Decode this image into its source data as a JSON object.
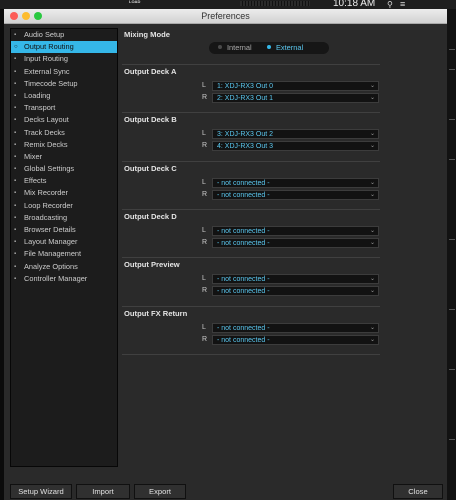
{
  "menubar": {
    "load_label": "LOAD",
    "clock": "10:18 AM",
    "search_icon": "search-icon",
    "menu_icon": "menu-list-icon"
  },
  "window": {
    "title": "Preferences"
  },
  "sidebar": {
    "items": [
      {
        "label": "Audio Setup"
      },
      {
        "label": "Output Routing",
        "active": true
      },
      {
        "label": "Input Routing"
      },
      {
        "label": "External Sync"
      },
      {
        "label": "Timecode Setup"
      },
      {
        "label": "Loading"
      },
      {
        "label": "Transport"
      },
      {
        "label": "Decks Layout"
      },
      {
        "label": "Track Decks"
      },
      {
        "label": "Remix Decks"
      },
      {
        "label": "Mixer"
      },
      {
        "label": "Global Settings"
      },
      {
        "label": "Effects"
      },
      {
        "label": "Mix Recorder"
      },
      {
        "label": "Loop Recorder"
      },
      {
        "label": "Broadcasting"
      },
      {
        "label": "Browser Details"
      },
      {
        "label": "Layout Manager"
      },
      {
        "label": "File Management"
      },
      {
        "label": "Analyze Options"
      },
      {
        "label": "Controller Manager"
      }
    ]
  },
  "mixing_mode": {
    "title": "Mixing Mode",
    "options": [
      {
        "label": "Internal",
        "selected": false
      },
      {
        "label": "External",
        "selected": true
      }
    ]
  },
  "sections": [
    {
      "title": "Output Deck A",
      "left_label": "L",
      "left": "1: XDJ-RX3 Out 0",
      "right_label": "R",
      "right": "2: XDJ-RX3 Out 1"
    },
    {
      "title": "Output Deck B",
      "left_label": "L",
      "left": "3: XDJ-RX3 Out 2",
      "right_label": "R",
      "right": "4: XDJ-RX3 Out 3"
    },
    {
      "title": "Output Deck C",
      "left_label": "L",
      "left": "- not connected -",
      "right_label": "R",
      "right": "- not connected -"
    },
    {
      "title": "Output Deck D",
      "left_label": "L",
      "left": "- not connected -",
      "right_label": "R",
      "right": "- not connected -"
    },
    {
      "title": "Output Preview",
      "left_label": "L",
      "left": "- not connected -",
      "right_label": "R",
      "right": "- not connected -"
    },
    {
      "title": "Output FX Return",
      "left_label": "L",
      "left": "- not connected -",
      "right_label": "R",
      "right": "- not connected -"
    }
  ],
  "footer": {
    "setup_wizard": "Setup Wizard",
    "import": "Import",
    "export": "Export",
    "close": "Close"
  },
  "colors": {
    "accent": "#35b7e8",
    "window_bg": "#2a2a2a",
    "sidebar_bg": "#1c1c1c"
  }
}
